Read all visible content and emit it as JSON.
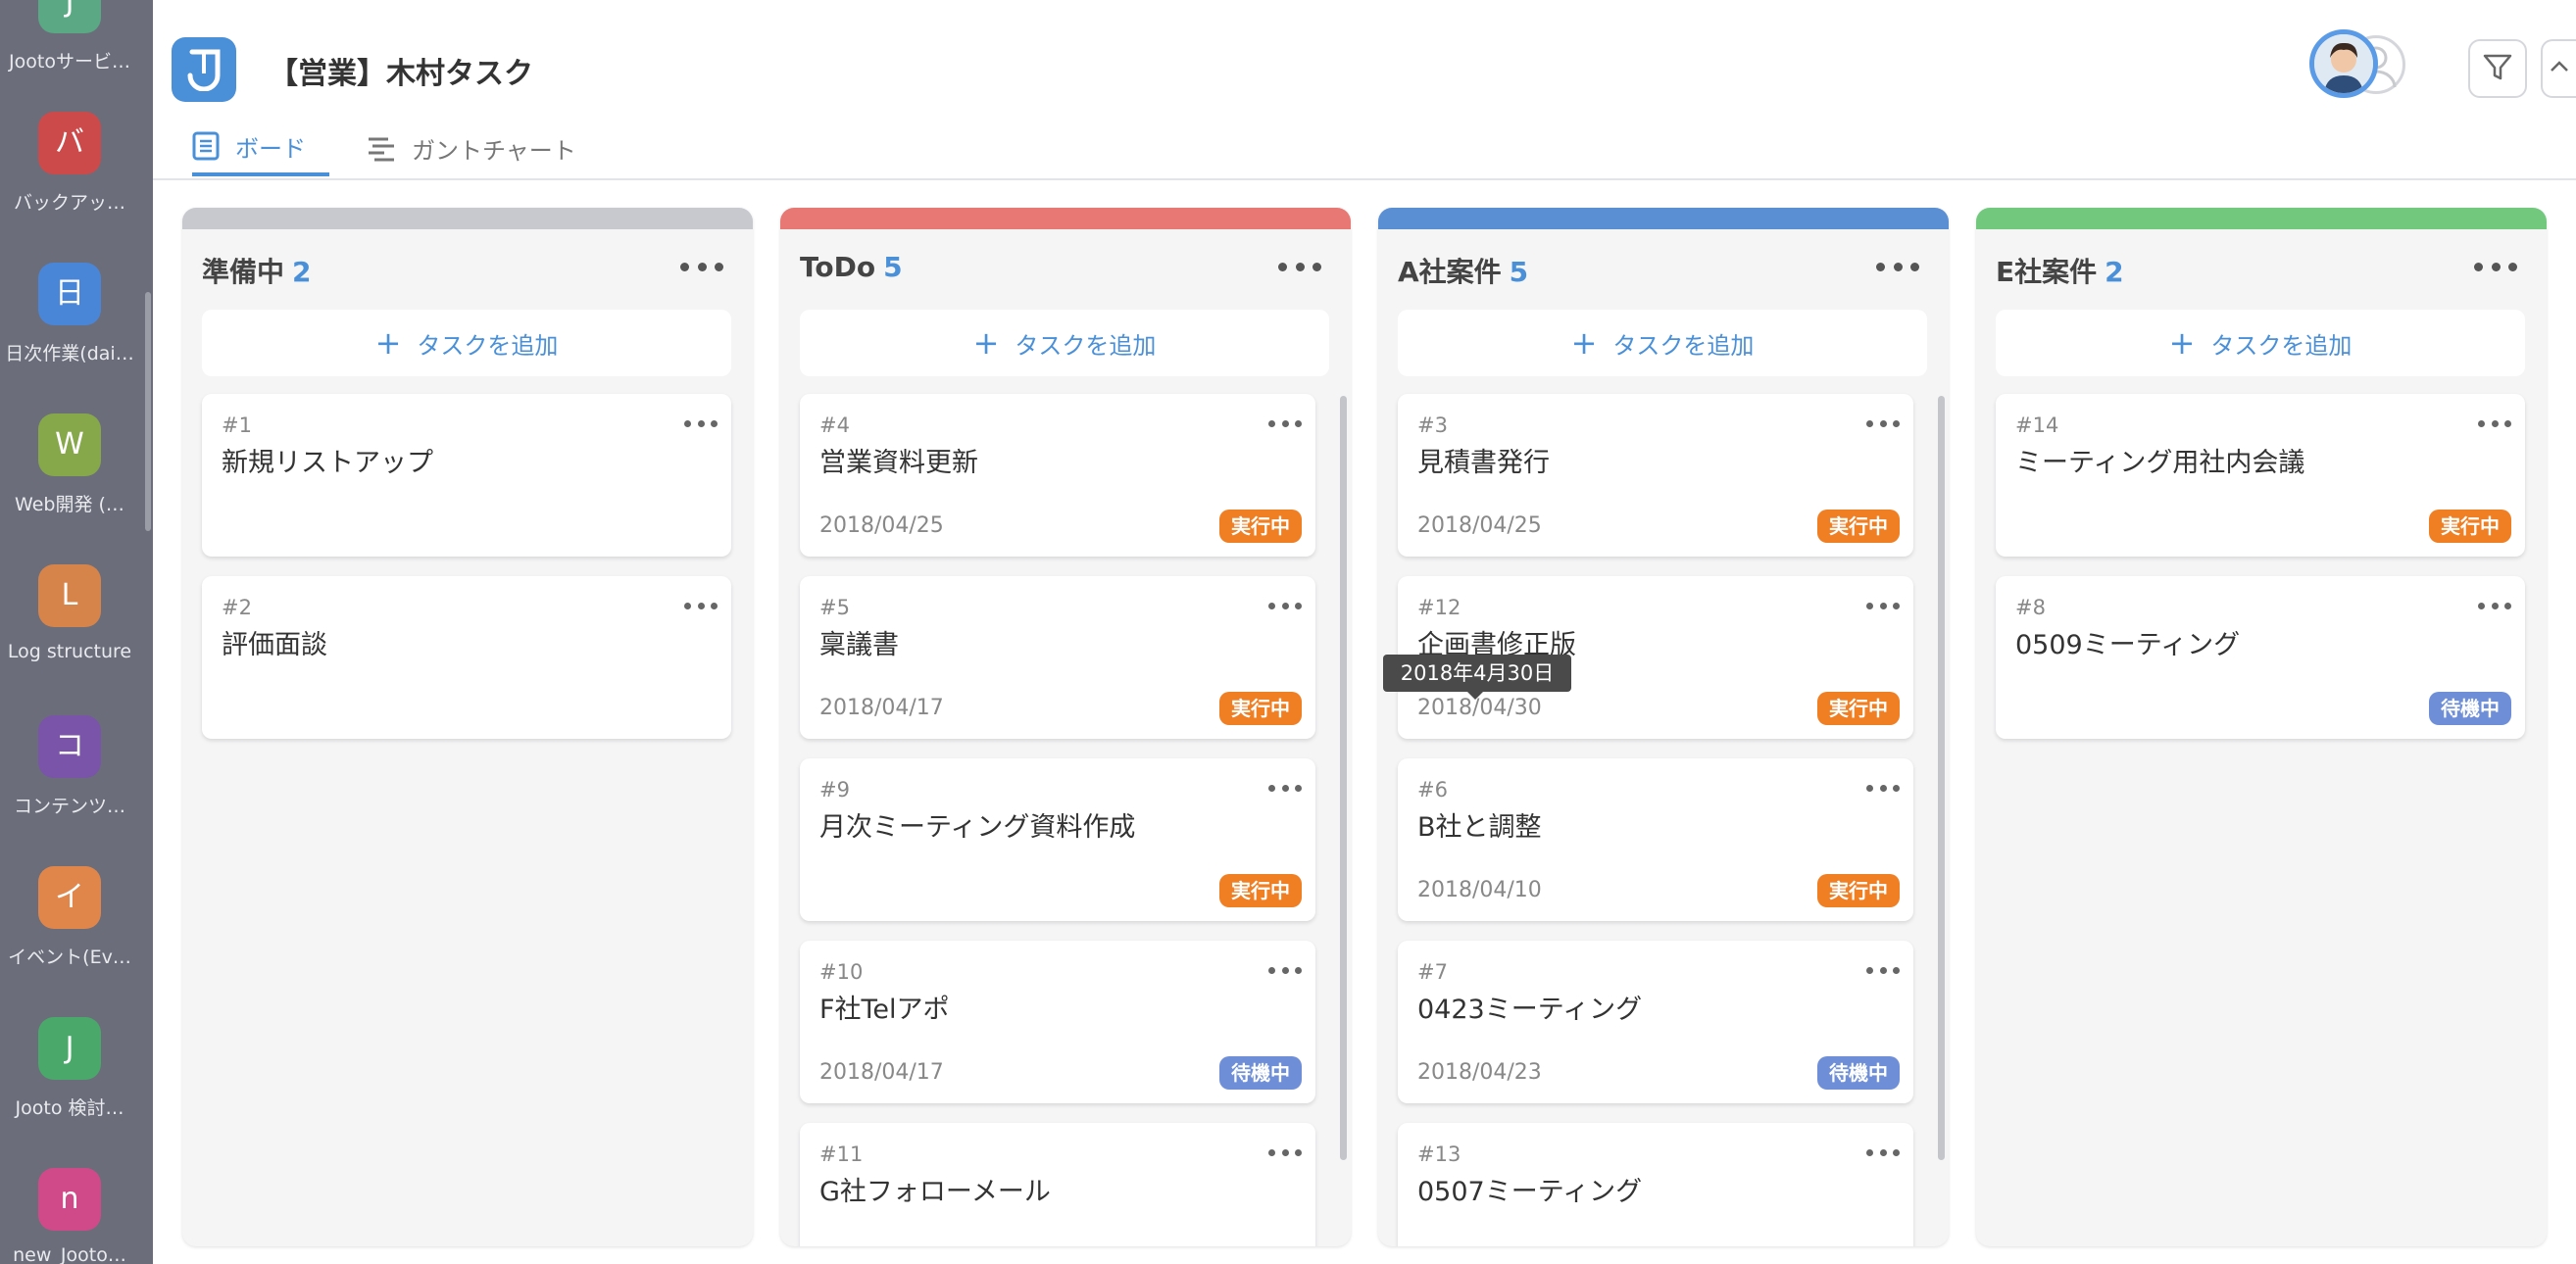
{
  "sidebar": {
    "projects": [
      {
        "initial": "J",
        "label": "Jootoサービ…",
        "color": "#5aa884"
      },
      {
        "initial": "バ",
        "label": "バックアッ…",
        "color": "#cc4a4a"
      },
      {
        "initial": "日",
        "label": "日次作業(dai…",
        "color": "#4a86d8"
      },
      {
        "initial": "W",
        "label": "Web開発 (…",
        "color": "#86a84a"
      },
      {
        "initial": "L",
        "label": "Log structure",
        "color": "#d6844a"
      },
      {
        "initial": "コ",
        "label": "コンテンツ…",
        "color": "#7a54a8"
      },
      {
        "initial": "イ",
        "label": "イベント(Ev…",
        "color": "#e0864a"
      },
      {
        "initial": "J",
        "label": "Jooto 検討…",
        "color": "#4aa86a"
      },
      {
        "initial": "n",
        "label": "new_Jooto…",
        "color": "#d04a8a"
      }
    ]
  },
  "header": {
    "title": "【営業】木村タスク",
    "tabs": [
      {
        "label": "ボード",
        "active": true
      },
      {
        "label": "ガントチャート",
        "active": false
      }
    ]
  },
  "columns": [
    {
      "name": "準備中",
      "count": "2",
      "color": "#c7c9cf",
      "add_label": "タスクを追加",
      "cards": [
        {
          "num": "#1",
          "title": "新規リストアップ",
          "date": "",
          "status": ""
        },
        {
          "num": "#2",
          "title": "評価面談",
          "date": "",
          "status": ""
        }
      ]
    },
    {
      "name": "ToDo",
      "count": "5",
      "color": "#e87873",
      "add_label": "タスクを追加",
      "cards": [
        {
          "num": "#4",
          "title": "営業資料更新",
          "date": "2018/04/25",
          "status": "実行中"
        },
        {
          "num": "#5",
          "title": "稟議書",
          "date": "2018/04/17",
          "status": "実行中"
        },
        {
          "num": "#9",
          "title": "月次ミーティング資料作成",
          "date": "",
          "status": "実行中"
        },
        {
          "num": "#10",
          "title": "F社Telアポ",
          "date": "2018/04/17",
          "status": "待機中"
        },
        {
          "num": "#11",
          "title": "G社フォローメール",
          "date": "",
          "status": ""
        }
      ]
    },
    {
      "name": "A社案件",
      "count": "5",
      "color": "#5a8fd4",
      "add_label": "タスクを追加",
      "cards": [
        {
          "num": "#3",
          "title": "見積書発行",
          "date": "2018/04/25",
          "status": "実行中"
        },
        {
          "num": "#12",
          "title": "企画書修正版",
          "date": "2018/04/30",
          "status": "実行中"
        },
        {
          "num": "#6",
          "title": "B社と調整",
          "date": "2018/04/10",
          "status": "実行中"
        },
        {
          "num": "#7",
          "title": "0423ミーティング",
          "date": "2018/04/23",
          "status": "待機中"
        },
        {
          "num": "#13",
          "title": "0507ミーティング",
          "date": "",
          "status": ""
        }
      ]
    },
    {
      "name": "E社案件",
      "count": "2",
      "color": "#72c97e",
      "add_label": "タスクを追加",
      "cards": [
        {
          "num": "#14",
          "title": "ミーティング用社内会議",
          "date": "",
          "status": "実行中"
        },
        {
          "num": "#8",
          "title": "0509ミーティング",
          "date": "",
          "status": "待機中"
        }
      ]
    }
  ],
  "tooltip": {
    "text": "2018年4月30日"
  },
  "status_colors": {
    "実行中": "#f07e22",
    "待機中": "#6e8fd8"
  }
}
